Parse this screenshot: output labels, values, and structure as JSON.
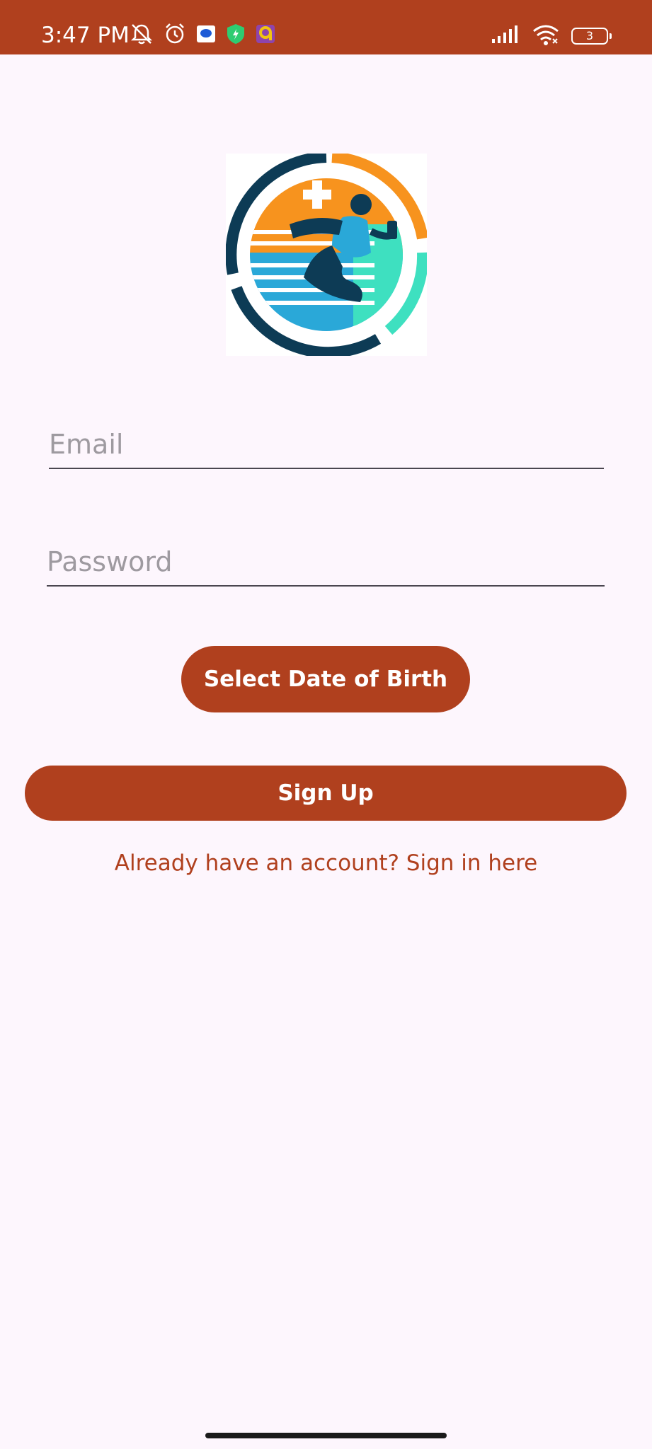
{
  "status_bar": {
    "time": "3:47 PM",
    "battery_level": "3",
    "background_color": "#b0401e",
    "left_icons": [
      "notifications-off-icon",
      "alarm-icon",
      "message-app-icon",
      "shield-app-icon",
      "app-icon"
    ],
    "right_icons": [
      "signal-icon",
      "wifi-icon",
      "battery-icon"
    ]
  },
  "logo": {
    "icon": "fitness-health-logo"
  },
  "form": {
    "email_placeholder": "Email",
    "email_value": "",
    "password_placeholder": "Password",
    "password_value": "",
    "dob_button_label": "Select Date of Birth",
    "signup_button_label": "Sign Up",
    "signin_link_text": "Already have an account? Sign in here"
  },
  "colors": {
    "accent": "#b0401e",
    "background": "#fdf6fd"
  }
}
